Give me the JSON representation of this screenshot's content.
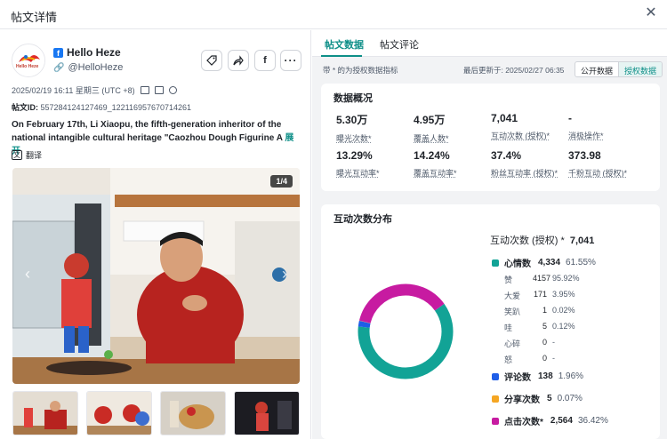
{
  "window": {
    "title": "帖文详情"
  },
  "profile": {
    "name": "Hello Heze",
    "handle": "@HelloHeze",
    "logo_text": "Hello Heze"
  },
  "post": {
    "datetime": "2025/02/19 16:11 星期三 (UTC +8)",
    "id_label": "帖文ID:",
    "id_value": "557284124127469_122116957670714261",
    "body": "On February 17th, Li Xiaopu, the fifth-generation inheritor of the national intangible cultural heritage \"Caozhou Dough Figurine A",
    "more": "展开",
    "translate": "翻译",
    "image_counter": "1/4"
  },
  "tabs": [
    {
      "label": "帖文数据"
    },
    {
      "label": "帖文评论"
    }
  ],
  "subbar": {
    "note": "带 * 的为授权数据指标",
    "updated": "最后更新于: 2025/02/27 06:35",
    "seg_public": "公开数据",
    "seg_auth": "授权数据"
  },
  "overview": {
    "title": "数据概况",
    "stats": [
      {
        "value": "5.30万",
        "label": "曝光次数*"
      },
      {
        "value": "4.95万",
        "label": "覆盖人数*"
      },
      {
        "value": "7,041",
        "label": "互动次数 (授权)*"
      },
      {
        "value": "-",
        "label": "消极操作*"
      },
      {
        "value": "13.29%",
        "label": "曝光互动率*"
      },
      {
        "value": "14.24%",
        "label": "覆盖互动率*"
      },
      {
        "value": "37.4%",
        "label": "粉丝互动率 (授权)*"
      },
      {
        "value": "373.98",
        "label": "千粉互动 (授权)*"
      }
    ]
  },
  "distribution": {
    "title": "互动次数分布",
    "total_label": "互动次数 (授权) *",
    "total_value": "7,041",
    "groups": [
      {
        "name": "心情数",
        "count": "4,334",
        "pct": "61.55%",
        "color": "#12a396",
        "subs": [
          {
            "name": "赞",
            "count": "4157",
            "pct": "95.92%"
          },
          {
            "name": "大爱",
            "count": "171",
            "pct": "3.95%"
          },
          {
            "name": "笑趴",
            "count": "1",
            "pct": "0.02%"
          },
          {
            "name": "哇",
            "count": "5",
            "pct": "0.12%"
          },
          {
            "name": "心碎",
            "count": "0",
            "pct": "-"
          },
          {
            "name": "怒",
            "count": "0",
            "pct": "-"
          }
        ]
      },
      {
        "name": "评论数",
        "count": "138",
        "pct": "1.96%",
        "color": "#1f5ee8"
      },
      {
        "name": "分享次数",
        "count": "5",
        "pct": "0.07%",
        "color": "#f5a623"
      },
      {
        "name": "点击次数*",
        "count": "2,564",
        "pct": "36.42%",
        "color": "#c71ba1"
      }
    ]
  },
  "chart_data": {
    "type": "pie",
    "categories": [
      "心情数",
      "评论数",
      "分享次数",
      "点击次数*"
    ],
    "values": [
      4334,
      138,
      5,
      2564
    ],
    "colors": [
      "#12a396",
      "#1f5ee8",
      "#f5a623",
      "#c71ba1"
    ],
    "donut": true
  }
}
